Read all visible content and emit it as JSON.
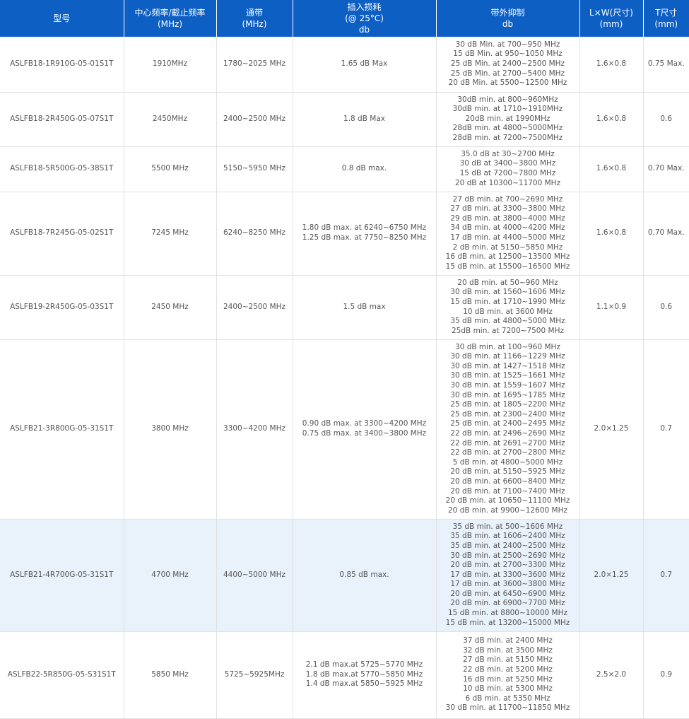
{
  "headers": [
    {
      "lines": [
        "型号"
      ]
    },
    {
      "lines": [
        "中心频率/截止频率",
        "(MHz)"
      ]
    },
    {
      "lines": [
        "通带",
        "(MHz)"
      ]
    },
    {
      "lines": [
        "插入损耗",
        "(@ 25°C)",
        "db"
      ]
    },
    {
      "lines": [
        "带外抑制",
        "db"
      ]
    },
    {
      "lines": [
        "L×W(尺寸)",
        "(mm)"
      ]
    },
    {
      "lines": [
        "T尺寸",
        "(mm)"
      ]
    }
  ],
  "rows": [
    {
      "cells": [
        [
          "ASLFB18-1R910G-05-01S1T"
        ],
        [
          "1910MHz"
        ],
        [
          "1780~2025 MHz"
        ],
        [
          "1.65 dB Max"
        ],
        [
          "30 dB Min. at 700~950 MHz",
          "15 dB Min. at 950~1050 MHz",
          "25 dB Min. at 2400~2500 MHz",
          "25 dB Min. at 2700~5400 MHz",
          "20 dB Min. at 5500~12500 MHz"
        ],
        [
          "1.6×0.8"
        ],
        [
          "0.75 Max."
        ]
      ]
    },
    {
      "cells": [
        [
          "ASLFB18-2R450G-05-07S1T"
        ],
        [
          "2450MHz"
        ],
        [
          "2400~2500 MHz"
        ],
        [
          "1.8 dB Max"
        ],
        [
          "30dB min. at 800~960MHz",
          "30dB min. at 1710~1910MHz",
          "20dB min. at 1990MHz",
          "28dB min. at 4800~5000MHz",
          "28dB min. at 7200~7500MHz"
        ],
        [
          "1.6×0.8"
        ],
        [
          "0.6"
        ]
      ]
    },
    {
      "cells": [
        [
          "ASLFB18-5R500G-05-38S1T"
        ],
        [
          "5500 MHz"
        ],
        [
          "5150~5950 MHz"
        ],
        [
          "0.8 dB max."
        ],
        [
          "35.0 dB at 30~2700 MHz",
          "30 dB at 3400~3800 MHz",
          "15 dB at 7200~7800 MHz",
          "20 dB at 10300~11700 MHz"
        ],
        [
          "1.6×0.8"
        ],
        [
          "0.70 Max."
        ]
      ]
    },
    {
      "cells": [
        [
          "ASLFB18-7R245G-05-02S1T"
        ],
        [
          "7245 MHz"
        ],
        [
          "6240~8250 MHz"
        ],
        [
          "1.80 dB max. at 6240~6750 MHz",
          "1.25 dB max. at 7750~8250 MHz"
        ],
        [
          "27 dB min. at 700~2690 MHz",
          "27 dB min. at 3300~3800 MHz",
          "29 dB min. at 3800~4000 MHz",
          "34 dB min. at 4000~4200 MHz",
          "17 dB min. at 4400~5000 MHz",
          "2 dB min. at 5150~5850 MHz",
          "16 dB min. at 12500~13500 MHz",
          "15 dB min. at 15500~16500 MHz"
        ],
        [
          "1.6×0.8"
        ],
        [
          "0.70 Max."
        ]
      ]
    },
    {
      "cells": [
        [
          "ASLFB19-2R450G-05-03S1T"
        ],
        [
          "2450 MHz"
        ],
        [
          "2400~2500 MHz"
        ],
        [
          "1.5 dB max"
        ],
        [
          "20 dB min. at 50~960 MHz",
          "30 dB min. at 1560~1606 MHz",
          "15 dB min. at 1710~1990 MHz",
          "10 dB min. at 3600 MHz",
          "35 dB min. at 4800~5000 MHz",
          "25dB min. at 7200~7500 MHz"
        ],
        [
          "1.1×0.9"
        ],
        [
          "0.6"
        ]
      ]
    },
    {
      "cells": [
        [
          "ASLFB21-3R800G-05-31S1T"
        ],
        [
          "3800 MHz"
        ],
        [
          "3300~4200 MHz"
        ],
        [
          "0.90 dB max. at 3300~4200 MHz",
          "0.75 dB max. at 3400~3800 MHz"
        ],
        [
          "30 dB min. at 100~960 MHz",
          "30 dB min. at 1166~1229 MHz",
          "30 dB min. at 1427~1518 MHz",
          "30 dB min. at 1525~1661 MHz",
          "30 dB min. at 1559~1607 MHz",
          "30 dB min. at 1695~1785 MHz",
          "25 dB min. at 1805~2200 MHz",
          "25 dB min. at 2300~2400 MHz",
          "25 dB min. at 2400~2495 MHz",
          "22 dB min. at 2496~2690 MHz",
          "22 dB min. at 2691~2700 MHz",
          "22 dB min. at 2700~2800 MHz",
          "5 dB min. at 4800~5000 MHz",
          "20 dB min. at 5150~5925 MHz",
          "20 dB min. at 6600~8400 MHz",
          "20 dB min. at 7100~7400 MHz",
          "20 dB min. at 10650~11100 MHz",
          "20 dB min. at 9900~12600 MHz"
        ],
        [
          "2.0×1.25"
        ],
        [
          "0.7"
        ]
      ]
    },
    {
      "highlight": true,
      "cells": [
        [
          "ASLFB21-4R700G-05-31S1T"
        ],
        [
          "4700 MHz"
        ],
        [
          "4400~5000 MHz"
        ],
        [
          "0.85 dB max."
        ],
        [
          "35 dB min. at 500~1606 MHz",
          "35 dB min. at 1606~2400 MHz",
          "35 dB min. at 2400~2500 MHz",
          "30 dB min. at 2500~2690 MHz",
          "20 dB min. at 2700~3300 MHz",
          "17 dB min. at 3300~3600 MHz",
          "17 dB min. at 3600~3800 MHz",
          "20 dB min. at 6450~6900 MHz",
          "20 dB min. at 6900~7700 MHz",
          "15 dB min. at 8800~10000 MHz",
          "15 dB min. at 13200~15000 MHz"
        ],
        [
          "2.0×1.25"
        ],
        [
          "0.7"
        ]
      ]
    },
    {
      "cells": [
        [
          "ASLFB22-5R850G-05-S31S1T"
        ],
        [
          "5850 MHz"
        ],
        [
          "5725~5925MHz"
        ],
        [
          "2.1 dB max.at 5725~5770 MHz",
          "1.8 dB max.at 5770~5850 MHz",
          "1.4 dB max.at 5850~5925 MHz"
        ],
        [
          "37 dB min. at 2400 MHz",
          "32 dB min. at 3500 MHz",
          "27 dB min. at 5150 MHz",
          "22 dB min. at 5200 MHz",
          "16 dB min. at 5250 MHz",
          "10 dB min. at 5300 MHz",
          "6 dB min. at 5350 MHz",
          "30 dB min. at 11700~11850 MHz"
        ],
        [
          "2.5×2.0"
        ],
        [
          "0.9"
        ]
      ]
    }
  ]
}
